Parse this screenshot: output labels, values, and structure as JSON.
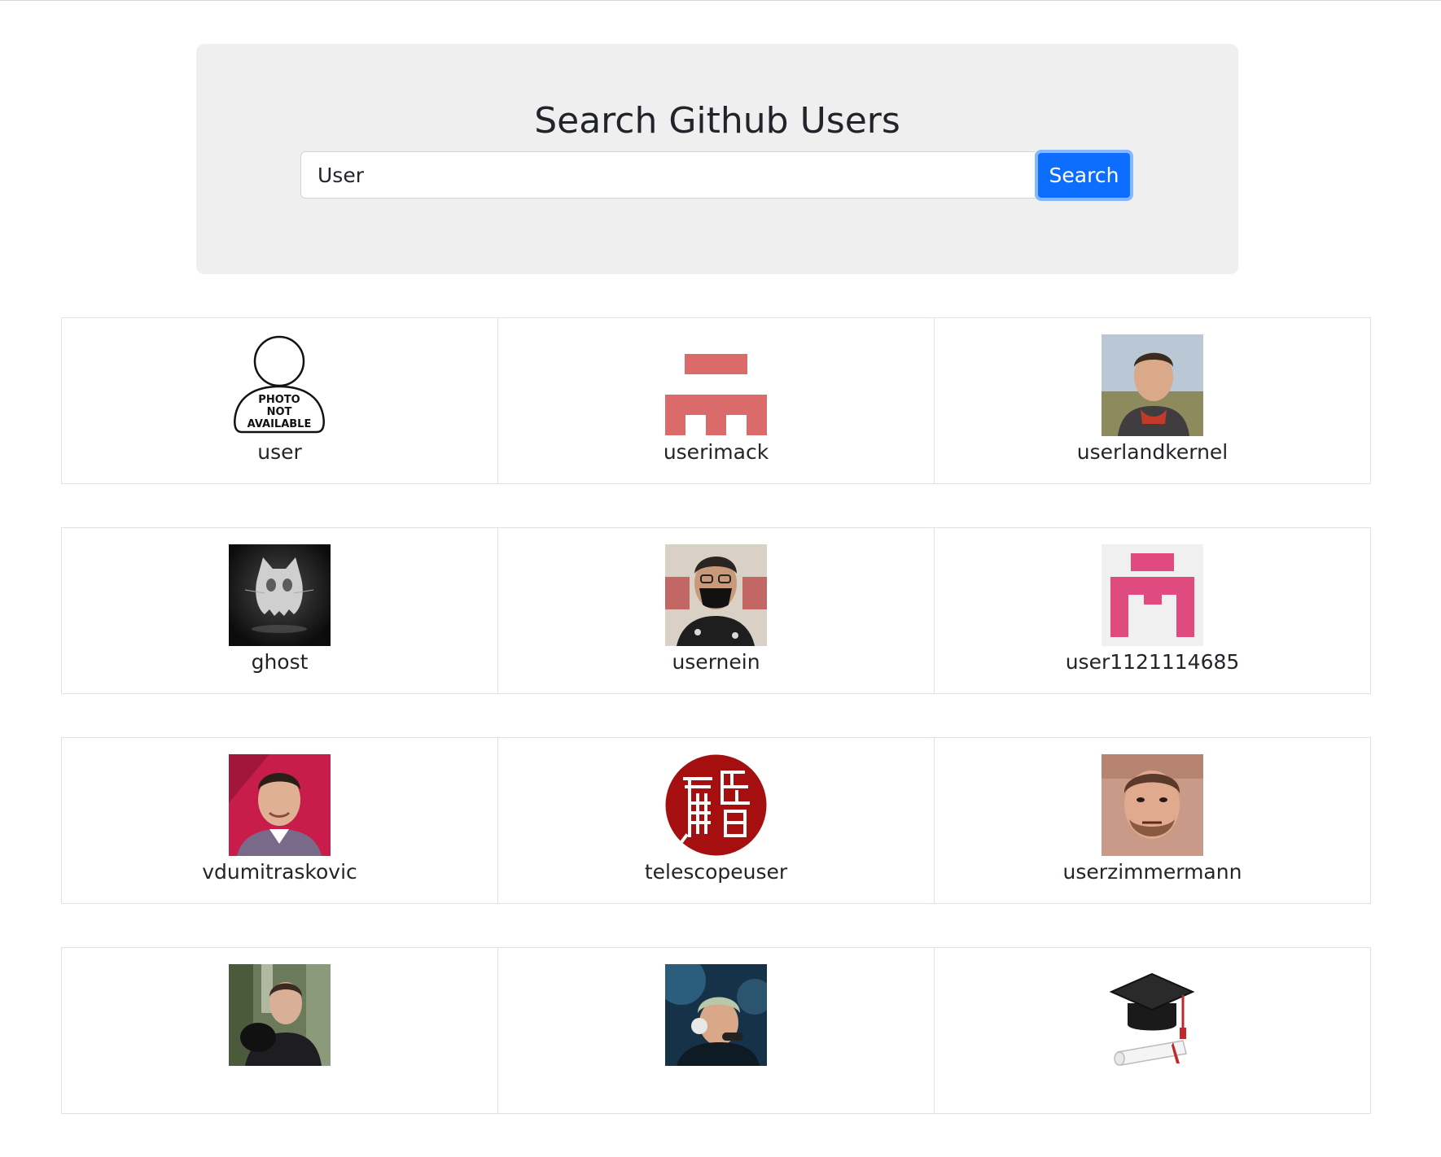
{
  "header": {
    "title": "Search Github Users"
  },
  "search": {
    "value": "User",
    "button_label": "Search"
  },
  "colors": {
    "jumbotron_bg": "#efefef",
    "button_bg": "#0d6efd",
    "button_focus_ring": "#86b7fe"
  },
  "placeholder_avatar": {
    "line1": "PHOTO",
    "line2": "NOT",
    "line3": "AVAILABLE"
  },
  "users": [
    {
      "login": "user",
      "avatar": "photo-not-available-icon"
    },
    {
      "login": "userimack",
      "avatar": "identicon-red"
    },
    {
      "login": "userlandkernel",
      "avatar": "photo-man-outdoors"
    },
    {
      "login": "ghost",
      "avatar": "ghost-octocat-icon"
    },
    {
      "login": "usernein",
      "avatar": "photo-man-mask"
    },
    {
      "login": "user1121114685",
      "avatar": "identicon-pink"
    },
    {
      "login": "vdumitraskovic",
      "avatar": "photo-man-red-bg"
    },
    {
      "login": "telescopeuser",
      "avatar": "seal-red-circle"
    },
    {
      "login": "userzimmermann",
      "avatar": "photo-man-beard"
    },
    {
      "login": "",
      "avatar": "photo-man-trees"
    },
    {
      "login": "",
      "avatar": "photo-man-headphones"
    },
    {
      "login": "",
      "avatar": "graduation-cap-icon"
    }
  ]
}
